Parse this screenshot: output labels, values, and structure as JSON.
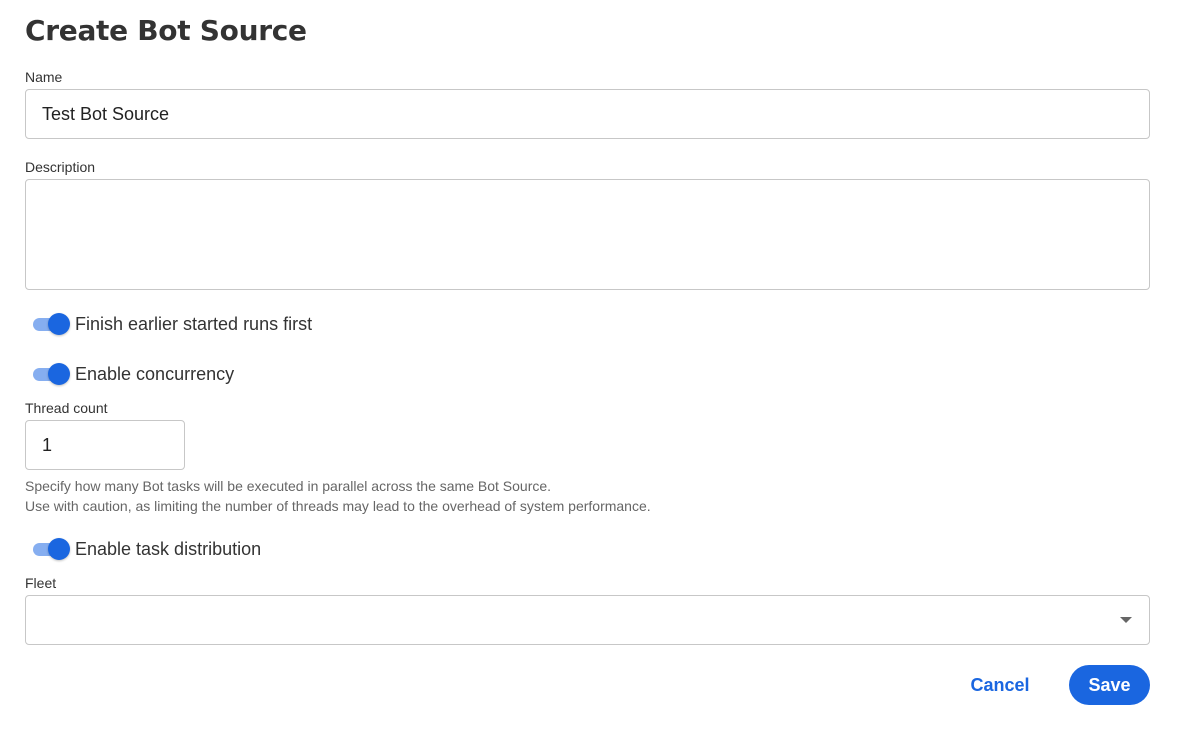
{
  "form": {
    "title": "Create Bot Source",
    "name": {
      "label": "Name",
      "value": "Test Bot Source"
    },
    "description": {
      "label": "Description",
      "value": ""
    },
    "toggles": [
      {
        "label": "Finish earlier started runs first",
        "checked": true
      },
      {
        "label": "Enable concurrency",
        "checked": true
      },
      {
        "label": "Enable task distribution",
        "checked": true
      }
    ],
    "thread_count": {
      "label": "Thread count",
      "value": "1",
      "help_line1": "Specify how many Bot tasks will be executed in parallel across the same Bot Source.",
      "help_line2": "Use with caution, as limiting the number of threads may lead to the overhead of system performance."
    },
    "fleet": {
      "label": "Fleet",
      "value": "",
      "icon": "chevron-down-icon"
    },
    "actions": {
      "cancel_label": "Cancel",
      "save_label": "Save"
    }
  },
  "colors": {
    "accent": "#1a66e0",
    "toggle_track": "#86aef0",
    "border": "#c7c7c7",
    "help_text": "#666666"
  }
}
